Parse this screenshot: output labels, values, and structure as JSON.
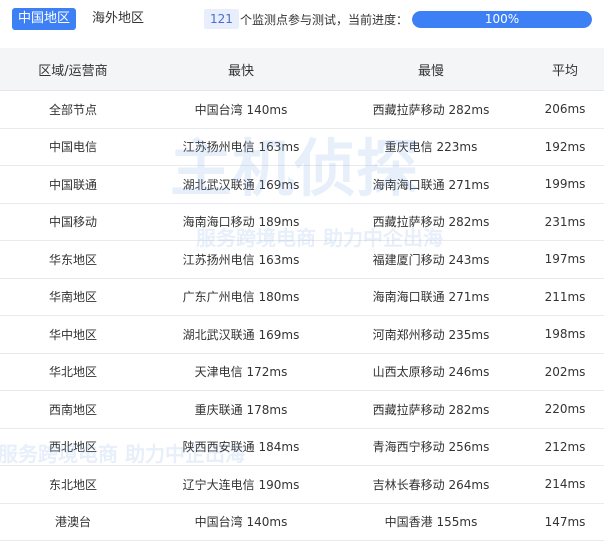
{
  "tabs": [
    {
      "label": "中国地区",
      "active": true
    },
    {
      "label": "海外地区",
      "active": false
    }
  ],
  "status": {
    "count": "121",
    "caption": "个监测点参与测试，当前进度：",
    "progress_percent": 100,
    "progress_label": "100%"
  },
  "table": {
    "headers": [
      "区域/运营商",
      "最快",
      "最慢",
      "平均"
    ],
    "rows": [
      [
        "全部节点",
        "中国台湾 140ms",
        "西藏拉萨移动 282ms",
        "206ms"
      ],
      [
        "中国电信",
        "江苏扬州电信 163ms",
        "重庆电信 223ms",
        "192ms"
      ],
      [
        "中国联通",
        "湖北武汉联通 169ms",
        "海南海口联通 271ms",
        "199ms"
      ],
      [
        "中国移动",
        "海南海口移动 189ms",
        "西藏拉萨移动 282ms",
        "231ms"
      ],
      [
        "华东地区",
        "江苏扬州电信 163ms",
        "福建厦门移动 243ms",
        "197ms"
      ],
      [
        "华南地区",
        "广东广州电信 180ms",
        "海南海口联通 271ms",
        "211ms"
      ],
      [
        "华中地区",
        "湖北武汉联通 169ms",
        "河南郑州移动 235ms",
        "198ms"
      ],
      [
        "华北地区",
        "天津电信 172ms",
        "山西太原移动 246ms",
        "202ms"
      ],
      [
        "西南地区",
        "重庆联通 178ms",
        "西藏拉萨移动 282ms",
        "220ms"
      ],
      [
        "西北地区",
        "陕西西安联通 184ms",
        "青海西宁移动 256ms",
        "212ms"
      ],
      [
        "东北地区",
        "辽宁大连电信 190ms",
        "吉林长春移动 264ms",
        "214ms"
      ],
      [
        "港澳台",
        "中国台湾 140ms",
        "中国香港 155ms",
        "147ms"
      ]
    ]
  },
  "watermark": {
    "brand": "主机侦探",
    "slogan": "服务跨境电商 助力中企出海"
  },
  "colors": {
    "accent": "#3d7ff5",
    "header_bg": "#f4f5f7"
  }
}
